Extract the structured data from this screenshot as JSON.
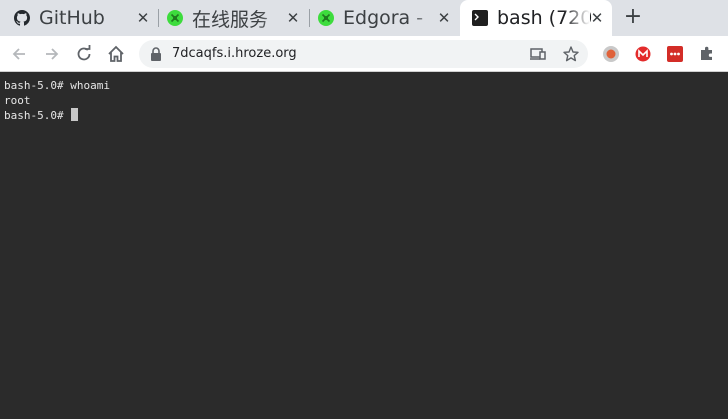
{
  "tabs": [
    {
      "title": "GitHub",
      "favicon": "github-icon",
      "active": false
    },
    {
      "title": "在线服务",
      "favicon": "green-globe-icon",
      "active": false
    },
    {
      "title": "Edgora -",
      "favicon": "green-globe-icon",
      "active": false
    },
    {
      "title": "bash (720",
      "favicon": "terminal-icon",
      "active": true
    }
  ],
  "newtab_label": "+",
  "close_glyph": "✕",
  "address_bar": {
    "url": "7dcaqfs.i.hroze.org"
  },
  "terminal": {
    "lines": [
      "bash-5.0# whoami",
      "root"
    ],
    "prompt": "bash-5.0# "
  },
  "colors": {
    "tabstrip": "#dee1e6",
    "terminal_bg": "#2b2b2b",
    "terminal_fg": "#e6e6e6",
    "favicon_green": "#3ddc3d",
    "ext_red": "#e32b2b"
  }
}
